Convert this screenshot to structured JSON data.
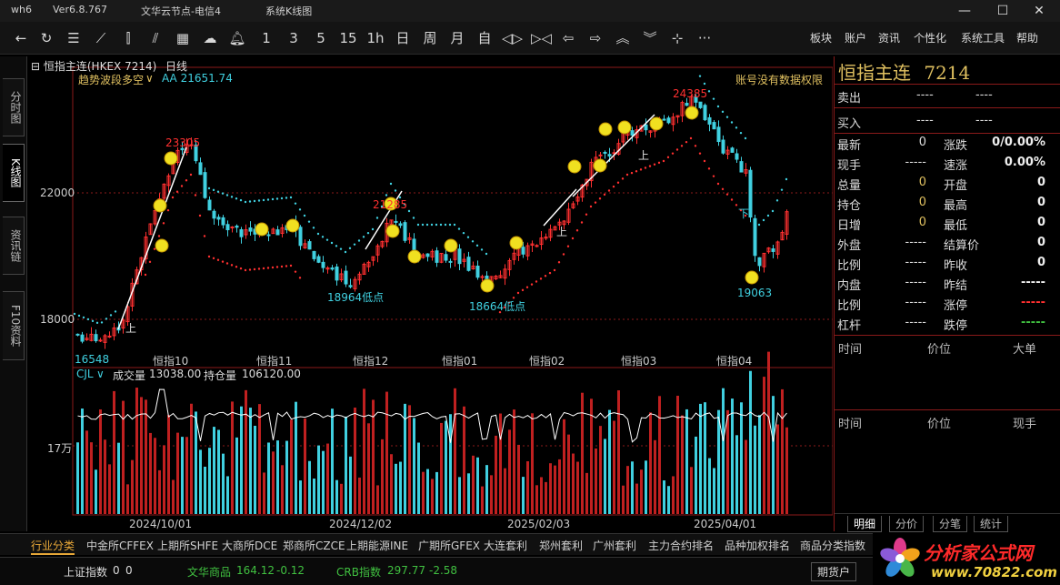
{
  "window": {
    "app_id": "wh6",
    "version": "Ver6.8.767",
    "server": "文华云节点-电信4",
    "mode": "系统K线图"
  },
  "toolbar": {
    "icons": [
      "back-arrow-icon",
      "refresh-icon",
      "list-icon",
      "line-chart-icon",
      "candle-icon",
      "tick-icon",
      "grid-icon",
      "cloud-icon",
      "bell-icon"
    ],
    "periods": [
      "1",
      "3",
      "5",
      "15",
      "1h",
      "日",
      "周",
      "月",
      "自"
    ],
    "menus": [
      "板块",
      "账户",
      "资讯",
      "个性化",
      "系统工具",
      "帮助"
    ]
  },
  "left_tabs": [
    "分时图",
    "K线图",
    "资讯链",
    "F10资料"
  ],
  "chart": {
    "contract": "恒指主连(HKEX 7214)",
    "period": "日线",
    "indicator_name": "趋势波段多空",
    "indicator_value": "AA 21651.74",
    "permission_note": "账号没有数据权限",
    "y_labels": [
      "22000",
      "18000"
    ],
    "month_labels": [
      "恒指10",
      "恒指11",
      "恒指12",
      "恒指01",
      "恒指02",
      "恒指03",
      "恒指04"
    ],
    "annotations": {
      "high1": "23305",
      "high2": "21285",
      "high3": "24385",
      "low1": "18964低点",
      "low2": "18664低点",
      "low3": "19063",
      "left_low": "16548",
      "sym_up": "上",
      "sym_down": "下"
    },
    "volume": {
      "indicator": "CJL",
      "volume_label": "成交量",
      "volume_value": "13038.00",
      "oi_label": "持仓量",
      "oi_value": "106120.00",
      "y_label": "17万"
    },
    "date_labels": [
      "2024/10/01",
      "2024/12/02",
      "2025/02/03",
      "2025/04/01"
    ],
    "watermark": "www.70822.com 分析家公式网"
  },
  "right_panel": {
    "title": "恒指主连",
    "code": "7214",
    "sell_label": "卖出",
    "sell_val1": "----",
    "sell_val2": "----",
    "buy_label": "买入",
    "buy_val1": "----",
    "buy_val2": "----",
    "left_rows": [
      {
        "label": "最新",
        "value": "0"
      },
      {
        "label": "现手",
        "value": "-----"
      },
      {
        "label": "总量",
        "value": "0"
      },
      {
        "label": "持仓",
        "value": "0"
      },
      {
        "label": "日增",
        "value": "0"
      },
      {
        "label": "外盘",
        "value": "-----"
      },
      {
        "label": "比例",
        "value": "-----"
      },
      {
        "label": "内盘",
        "value": "-----"
      },
      {
        "label": "比例",
        "value": "-----"
      },
      {
        "label": "杠杆",
        "value": "-----"
      }
    ],
    "right_rows": [
      {
        "label": "涨跌",
        "value": "0/0.00%"
      },
      {
        "label": "速涨",
        "value": "0.00%"
      },
      {
        "label": "开盘",
        "value": "0"
      },
      {
        "label": "最高",
        "value": "0"
      },
      {
        "label": "最低",
        "value": "0"
      },
      {
        "label": "结算价",
        "value": "0"
      },
      {
        "label": "昨收",
        "value": "0"
      },
      {
        "label": "昨结",
        "value": "-----"
      },
      {
        "label": "涨停",
        "value": "-----"
      },
      {
        "label": "跌停",
        "value": "-----"
      }
    ],
    "tick_headers": [
      "时间",
      "价位",
      "大单"
    ],
    "tick_headers2": [
      "时间",
      "价位",
      "现手"
    ],
    "tabs": [
      "明细",
      "分价",
      "分笔",
      "统计"
    ]
  },
  "bottom_tabs": [
    "行业分类",
    "中金所CFFEX",
    "上期所SHFE",
    "大商所DCE",
    "郑商所CZCE",
    "上期能源INE",
    "广期所GFEX",
    "大连套利",
    "郑州套利",
    "广州套利",
    "主力合约排名",
    "品种加权排名",
    "商品分类指数"
  ],
  "status_bar": {
    "item1_label": "上证指数",
    "item1_v1": "0",
    "item1_v2": "0",
    "item2_label": "文华商品",
    "item2_v1": "164.12",
    "item2_v2": "-0.12",
    "item3_label": "CRB指数",
    "item3_v1": "297.77",
    "item3_v2": "-2.58",
    "btn": "期货户"
  },
  "logo": {
    "name": "分析家公式网",
    "url": "www.70822.com"
  },
  "colors": {
    "up": "#ff3030",
    "down": "#40d0e0",
    "grid_red": "#8b1a1a",
    "yellow": "#e0c060"
  }
}
